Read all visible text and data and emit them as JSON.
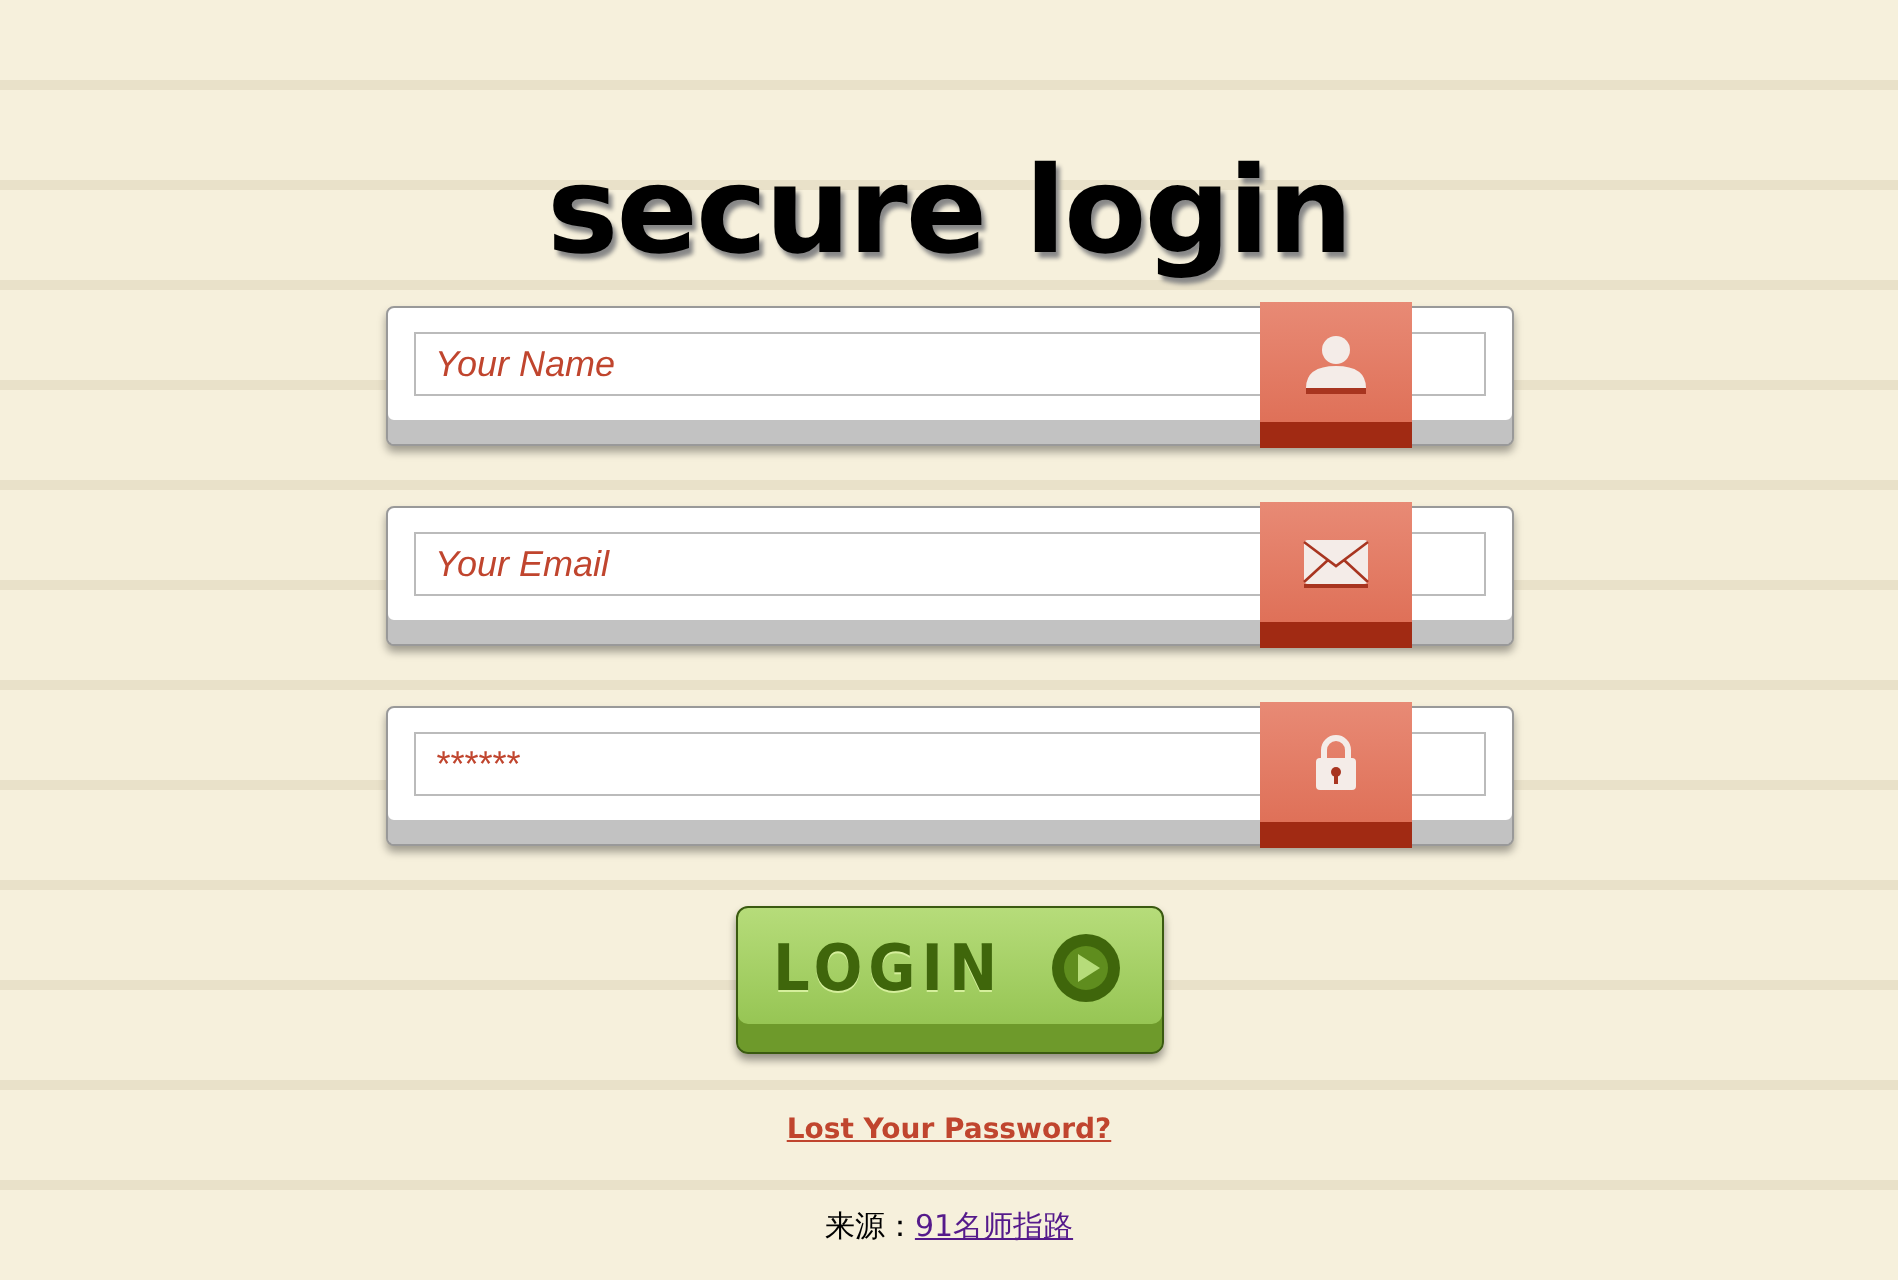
{
  "title": "secure login",
  "fields": [
    {
      "kind": "person",
      "placeholder": "Your Name"
    },
    {
      "kind": "mail",
      "placeholder": "Your Email"
    },
    {
      "kind": "lock",
      "placeholder": "******"
    }
  ],
  "login_button": {
    "label": "LOGIN"
  },
  "lost_password_link": "Lost Your Password?",
  "source": {
    "label": "来源：",
    "link": "91名师指路"
  }
}
